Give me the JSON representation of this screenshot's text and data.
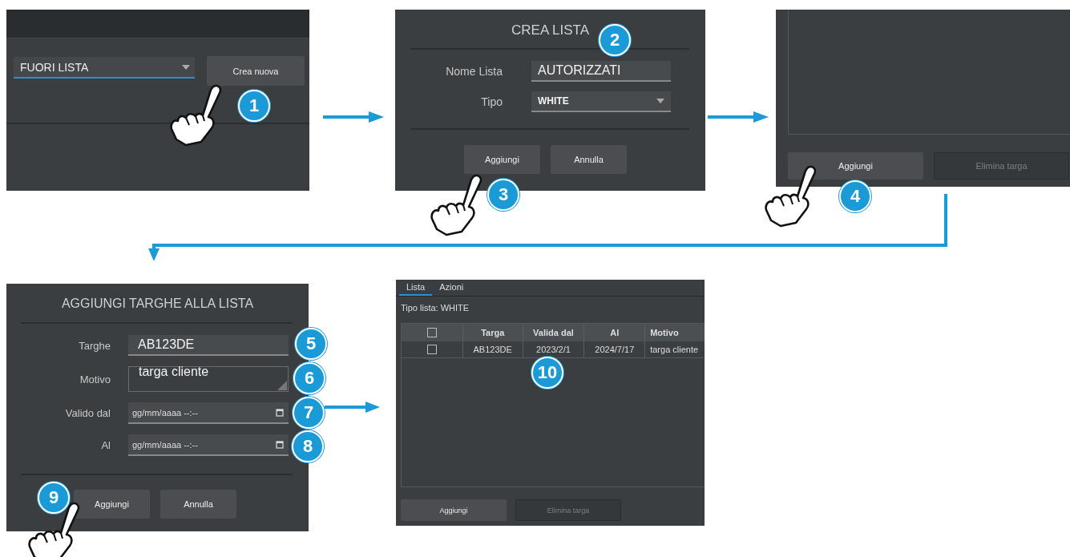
{
  "panel_select": {
    "dropdown": {
      "value": "FUORI LISTA"
    },
    "button": "Crea nuova"
  },
  "dialog_create": {
    "title": "CREA LISTA",
    "fields": [
      {
        "label": "Nome Lista",
        "kind": "text",
        "value": "AUTORIZZATI"
      },
      {
        "label": "Tipo",
        "kind": "select",
        "value": "WHITE"
      }
    ],
    "buttons": [
      {
        "label": "Aggiungi",
        "disabled": false
      },
      {
        "label": "Annulla",
        "disabled": false
      }
    ]
  },
  "panel_list": {
    "buttons": [
      {
        "label": "Aggiungi",
        "disabled": false
      },
      {
        "label": "Elimina targa",
        "disabled": true
      }
    ]
  },
  "dialog_add": {
    "title": "AGGIUNGI TARGHE ALLA LISTA",
    "fields": [
      {
        "label": "Targhe",
        "kind": "text",
        "value": "AB123DE"
      },
      {
        "label": "Motivo",
        "kind": "textarea",
        "value": "targa cliente"
      },
      {
        "label": "Valido dal",
        "kind": "datetime",
        "placeholder": "gg/mm/aaaa --:--"
      },
      {
        "label": "Al",
        "kind": "datetime",
        "placeholder": "gg/mm/aaaa --:--"
      }
    ],
    "buttons": [
      {
        "label": "Aggiungi",
        "disabled": false
      },
      {
        "label": "Annulla",
        "disabled": false
      }
    ]
  },
  "result": {
    "tabs": [
      {
        "label": "Lista",
        "selected": true
      },
      {
        "label": "Azioni",
        "selected": false
      }
    ],
    "list_type": "Tipo lista: WHITE",
    "table": {
      "header_checked": false,
      "columns": [
        "Targa",
        "Valida dal",
        "Al",
        "Motivo"
      ],
      "rows": [
        {
          "checked": false,
          "cells": [
            "AB123DE",
            "2023/2/1",
            "2024/7/17",
            "targa cliente"
          ]
        }
      ]
    },
    "buttons": [
      {
        "label": "Aggiungi",
        "disabled": false
      },
      {
        "label": "Elimina targa",
        "disabled": true
      }
    ]
  },
  "step_markers": [
    "1",
    "2",
    "3",
    "4",
    "5",
    "6",
    "7",
    "8",
    "9",
    "10"
  ]
}
